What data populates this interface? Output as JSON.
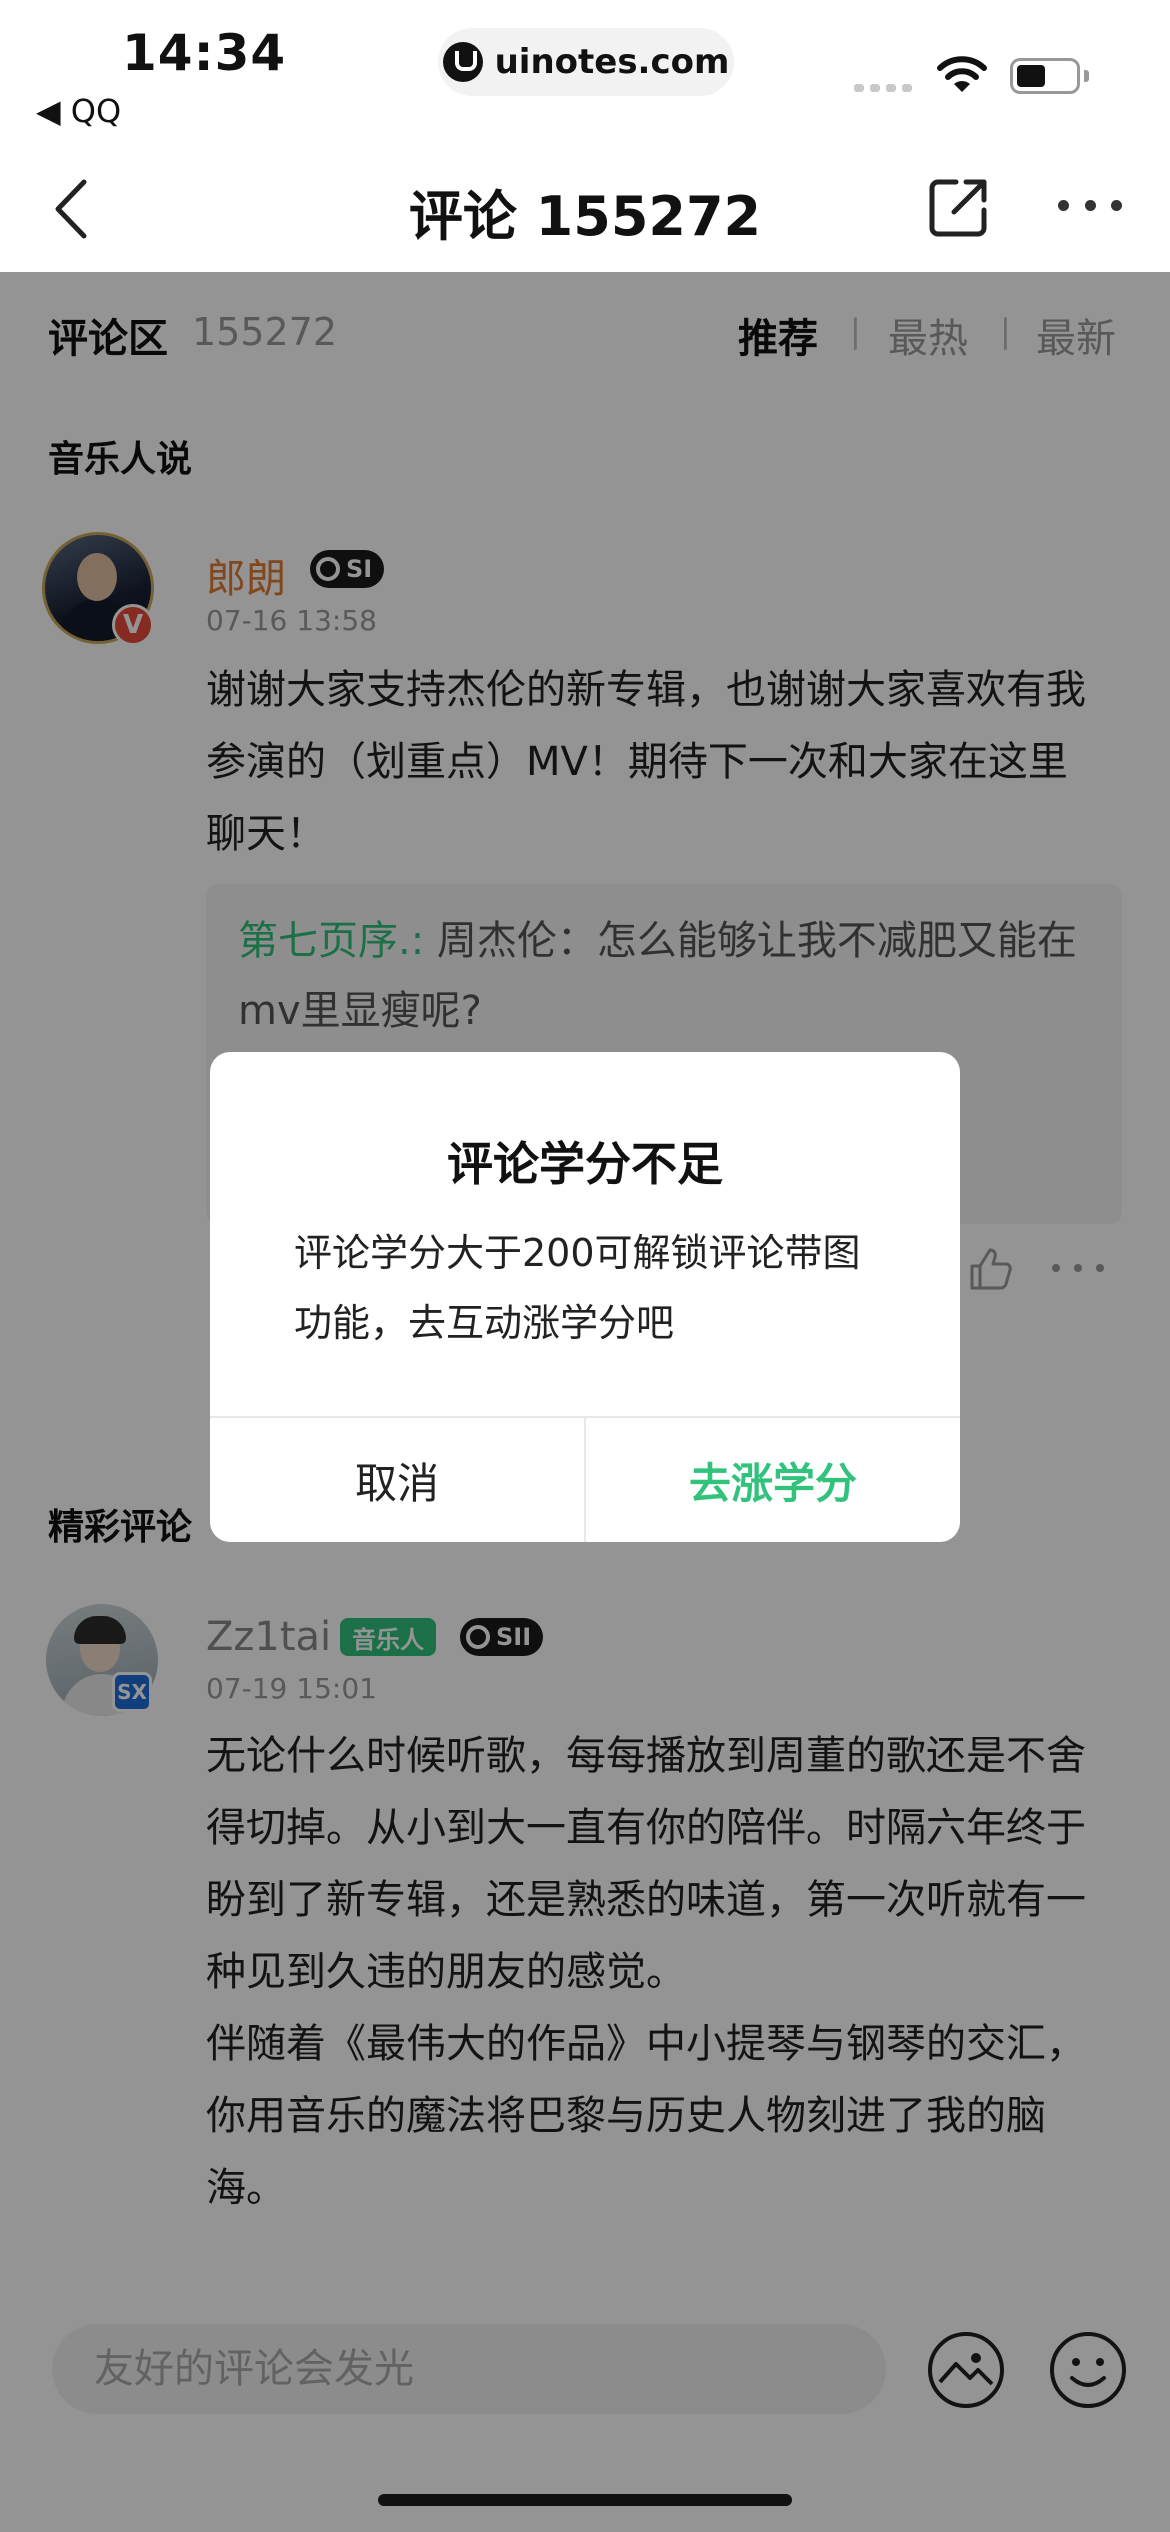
{
  "status_bar": {
    "time": "14:34",
    "back_app": "◀ QQ",
    "url": "uinotes.com"
  },
  "nav": {
    "title": "评论 155272"
  },
  "comments_header": {
    "title": "评论区",
    "count": "155272",
    "sort_options": [
      "推荐",
      "最热",
      "最新"
    ],
    "separator": "|"
  },
  "musician_section": {
    "title": "音乐人说",
    "comment": {
      "username": "郎朗",
      "level": "SI",
      "verified_badge": "V",
      "date": "07-16 13:58",
      "text": "谢谢大家支持杰伦的新专辑，也谢谢大家喜欢有我参演的（划重点）MV！期待下一次和大家在这里聊天！",
      "quote_author": "第七页序.:",
      "quote_text": " 周杰伦：怎么能够让我不减肥又能在mv里显瘦呢?"
    }
  },
  "featured_section": {
    "title": "精彩评论",
    "comment": {
      "username": "Zz1tai",
      "music_tag": "音乐人",
      "level": "SII",
      "avatar_badge": "SX",
      "date": "07-19 15:01",
      "text": "无论什么时候听歌，每每播放到周董的歌还是不舍得切掉。从小到大一直有你的陪伴。时隔六年终于盼到了新专辑，还是熟悉的味道，第一次听就有一种见到久违的朋友的感觉。\n伴随着《最伟大的作品》中小提琴与钢琴的交汇，你用音乐的魔法将巴黎与历史人物刻进了我的脑海。"
    }
  },
  "input": {
    "placeholder": "友好的评论会发光"
  },
  "dialog": {
    "title": "评论学分不足",
    "message": "评论学分大于200可解锁评论带图功能，去互动涨学分吧",
    "cancel": "取消",
    "confirm": "去涨学分"
  },
  "colors": {
    "accent_green": "#31c27c",
    "musician_name": "#e07b33",
    "overlay": "rgba(0,0,0,0.42)"
  },
  "icons": [
    "back-arrow-icon",
    "share-icon",
    "more-icon",
    "like-icon",
    "image-icon",
    "emoji-icon",
    "wifi-icon",
    "battery-icon"
  ]
}
